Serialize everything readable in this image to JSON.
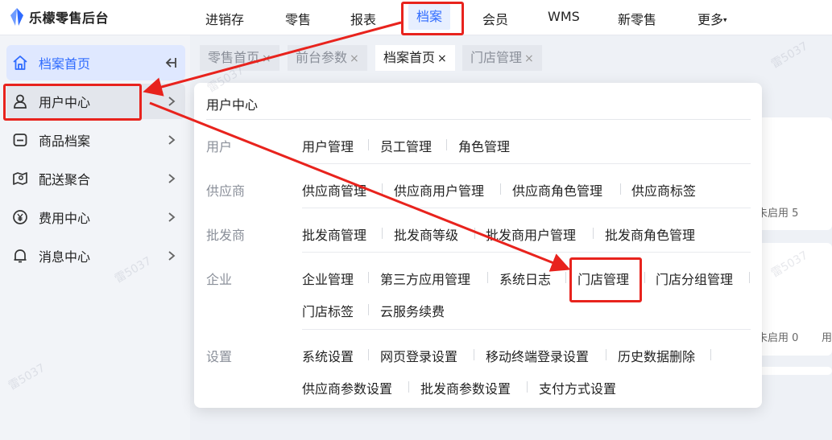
{
  "brand": {
    "name": "乐檬零售后台",
    "logo_icon": "diamond-logo-icon",
    "accent": "#2f6bff"
  },
  "topnav": {
    "items": [
      "进销存",
      "零售",
      "报表",
      "档案",
      "会员",
      "WMS",
      "新零售",
      "更多"
    ],
    "active": "档案",
    "more_caret": "▾"
  },
  "sidebar": {
    "items": [
      {
        "label": "档案首页",
        "icon": "home-icon"
      },
      {
        "label": "用户中心",
        "icon": "user-icon"
      },
      {
        "label": "商品档案",
        "icon": "box-icon"
      },
      {
        "label": "配送聚合",
        "icon": "map-icon"
      },
      {
        "label": "费用中心",
        "icon": "yen-icon"
      },
      {
        "label": "消息中心",
        "icon": "bell-icon"
      }
    ],
    "collapse_icon": "collapse-left-icon"
  },
  "tabs": [
    {
      "label": "零售首页",
      "close": "×"
    },
    {
      "label": "前台参数",
      "close": "×"
    },
    {
      "label": "档案首页",
      "close": "×"
    },
    {
      "label": "门店管理",
      "close": "×"
    }
  ],
  "background": {
    "status1": "未启用 5",
    "status2": "未启用 0",
    "status3": "用"
  },
  "menu": {
    "title": "用户中心",
    "groups": [
      {
        "label": "用户",
        "links": [
          "用户管理",
          "员工管理",
          "角色管理"
        ]
      },
      {
        "label": "供应商",
        "links": [
          "供应商管理",
          "供应商用户管理",
          "供应商角色管理",
          "供应商标签"
        ]
      },
      {
        "label": "批发商",
        "links": [
          "批发商管理",
          "批发商等级",
          "批发商用户管理",
          "批发商角色管理"
        ]
      },
      {
        "label": "企业",
        "links": [
          "企业管理",
          "第三方应用管理",
          "系统日志",
          "门店管理",
          "门店分组管理",
          "门店标签",
          "云服务续费"
        ]
      },
      {
        "label": "设置",
        "links": [
          "系统设置",
          "网页登录设置",
          "移动终端登录设置",
          "历史数据删除",
          "供应商参数设置",
          "批发商参数设置",
          "支付方式设置"
        ]
      }
    ]
  },
  "watermark": "雷5037",
  "annotation_color": "#e8231d"
}
